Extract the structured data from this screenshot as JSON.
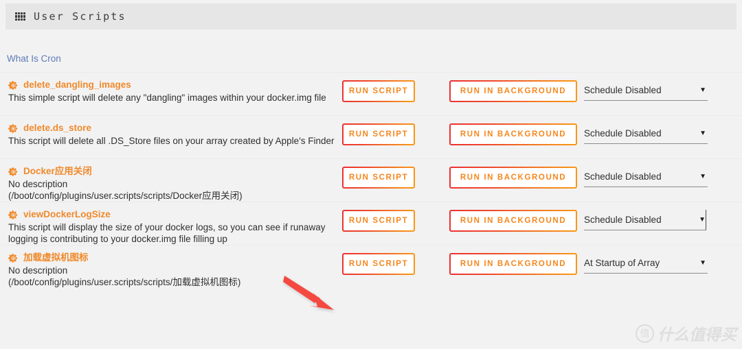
{
  "header": {
    "icon": "grid-apps-icon",
    "title": "User Scripts"
  },
  "links": {
    "what_is_cron": "What Is Cron"
  },
  "buttons": {
    "run_script": "RUN SCRIPT",
    "run_in_background": "RUN IN BACKGROUND"
  },
  "colors": {
    "accent_orange": "#f0892a",
    "button_gradient_start": "#ec2f31",
    "button_gradient_end": "#f89a14",
    "link_blue": "#5d7ab8",
    "arrow_red": "#f4483f",
    "header_bg": "#e6e6e6",
    "page_bg": "#f2f2f2"
  },
  "scripts": [
    {
      "icon": "gear-icon",
      "name": "delete_dangling_images",
      "description": "This simple script will delete any \"dangling\" images within your docker.img file",
      "path": "",
      "run_label": "RUN SCRIPT",
      "background_label": "RUN IN BACKGROUND",
      "schedule": "Schedule Disabled"
    },
    {
      "icon": "gear-icon",
      "name": "delete.ds_store",
      "description": "This script will delete all .DS_Store files on your array created by Apple's Finder",
      "path": "",
      "run_label": "RUN SCRIPT",
      "background_label": "RUN IN BACKGROUND",
      "schedule": "Schedule Disabled"
    },
    {
      "icon": "gear-icon",
      "name": "Docker应用关闭",
      "description": "No description",
      "path": "(/boot/config/plugins/user.scripts/scripts/Docker应用关闭)",
      "run_label": "RUN SCRIPT",
      "background_label": "RUN IN BACKGROUND",
      "schedule": "Schedule Disabled"
    },
    {
      "icon": "gear-icon",
      "name": "viewDockerLogSize",
      "description": "This script will display the size of your docker logs, so you can see if runaway logging is contributing to your docker.img file filling up",
      "path": "",
      "run_label": "RUN SCRIPT",
      "background_label": "RUN IN BACKGROUND",
      "schedule": "Schedule Disabled"
    },
    {
      "icon": "gear-icon",
      "name": "加载虚拟机图标",
      "description": "No description",
      "path": "(/boot/config/plugins/user.scripts/scripts/加载虚拟机图标)",
      "run_label": "RUN SCRIPT",
      "background_label": "RUN IN BACKGROUND",
      "schedule": "At Startup of Array"
    }
  ],
  "annotation": {
    "arrow": "red-arrow-pointing-to-run-script"
  },
  "watermark": {
    "badge": "值",
    "text": "什么值得买"
  }
}
